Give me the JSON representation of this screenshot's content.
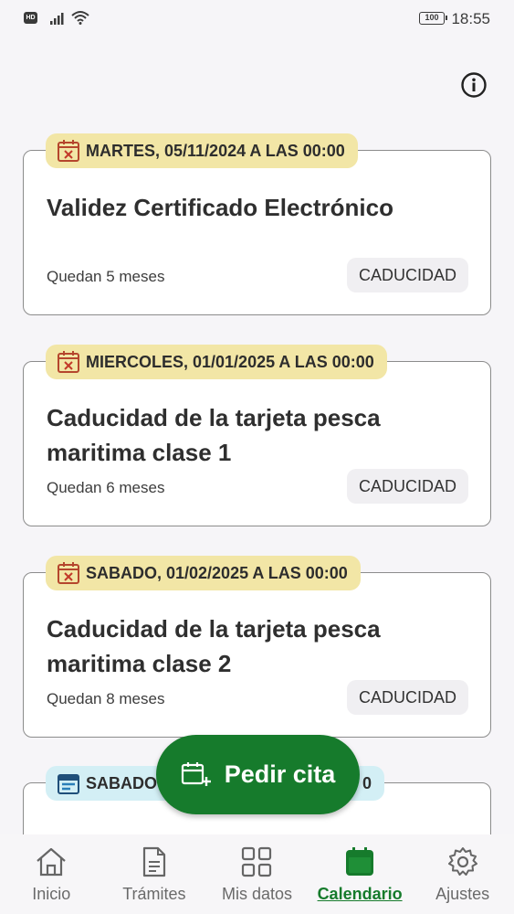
{
  "status_bar": {
    "network_badge": "HD",
    "battery": "100",
    "time": "18:55"
  },
  "events": [
    {
      "date_label": "MARTES, 05/11/2024 A LAS 00:00",
      "title": "Validez Certificado Electrónico",
      "remaining": "Quedan 5 meses",
      "type": "CADUCIDAD",
      "icon": "calendar-x-icon"
    },
    {
      "date_label": "MIERCOLES, 01/01/2025 A LAS 00:00",
      "title": "Caducidad de la tarjeta pesca maritima clase 1",
      "remaining": "Quedan 6 meses",
      "type": "CADUCIDAD",
      "icon": "calendar-x-icon"
    },
    {
      "date_label": "SABADO, 01/02/2025 A LAS 00:00",
      "title": "Caducidad de la tarjeta pesca maritima clase 2",
      "remaining": "Quedan 8 meses",
      "type": "CADUCIDAD",
      "icon": "calendar-x-icon"
    },
    {
      "date_label_left": "SABADO",
      "date_label_right": "0",
      "title": "",
      "icon": "calendar-event-icon"
    }
  ],
  "fab": {
    "label": "Pedir cita",
    "icon": "calendar-plus-icon"
  },
  "nav": {
    "items": [
      {
        "label": "Inicio",
        "icon": "home-icon"
      },
      {
        "label": "Trámites",
        "icon": "document-icon"
      },
      {
        "label": "Mis datos",
        "icon": "grid-icon"
      },
      {
        "label": "Calendario",
        "icon": "calendar-icon",
        "active": true
      },
      {
        "label": "Ajustes",
        "icon": "gear-icon"
      }
    ]
  },
  "colors": {
    "accent": "#167b2c",
    "tag_yellow": "#f2e6a6",
    "tag_blue": "#d3eff5"
  }
}
